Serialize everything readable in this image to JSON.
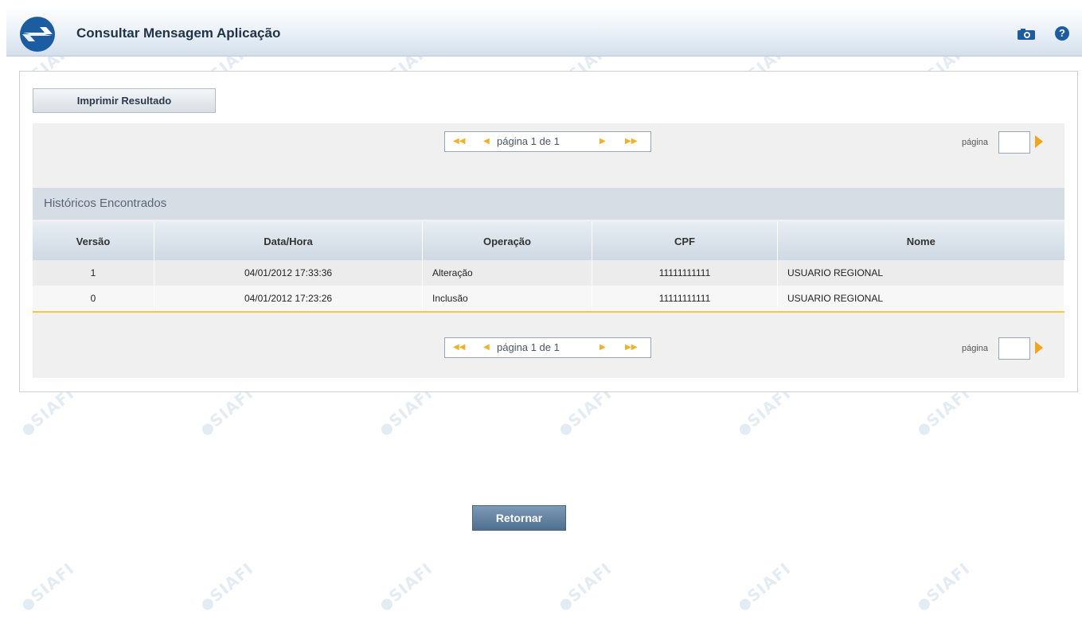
{
  "header": {
    "title": "Consultar Mensagem Aplicação"
  },
  "toolbar": {
    "print_label": "Imprimir Resultado",
    "return_label": "Retornar"
  },
  "pager": {
    "text": "página 1 de 1",
    "goto_label": "página",
    "goto_value": ""
  },
  "section": {
    "title": "Históricos Encontrados"
  },
  "table": {
    "columns": [
      "Versão",
      "Data/Hora",
      "Operação",
      "CPF",
      "Nome"
    ],
    "rows": [
      [
        "1",
        "04/01/2012 17:33:36",
        "Alteração",
        "11111111111",
        "USUARIO REGIONAL"
      ],
      [
        "0",
        "04/01/2012 17:23:26",
        "Inclusão",
        "11111111111",
        "USUARIO REGIONAL"
      ]
    ]
  },
  "watermark": "SIAFI",
  "colors": {
    "accent": "#f2b125",
    "header_bg": "#d6dde4",
    "button_primary": "#5b7ea1",
    "cpf_text": "#7a1e6a"
  }
}
